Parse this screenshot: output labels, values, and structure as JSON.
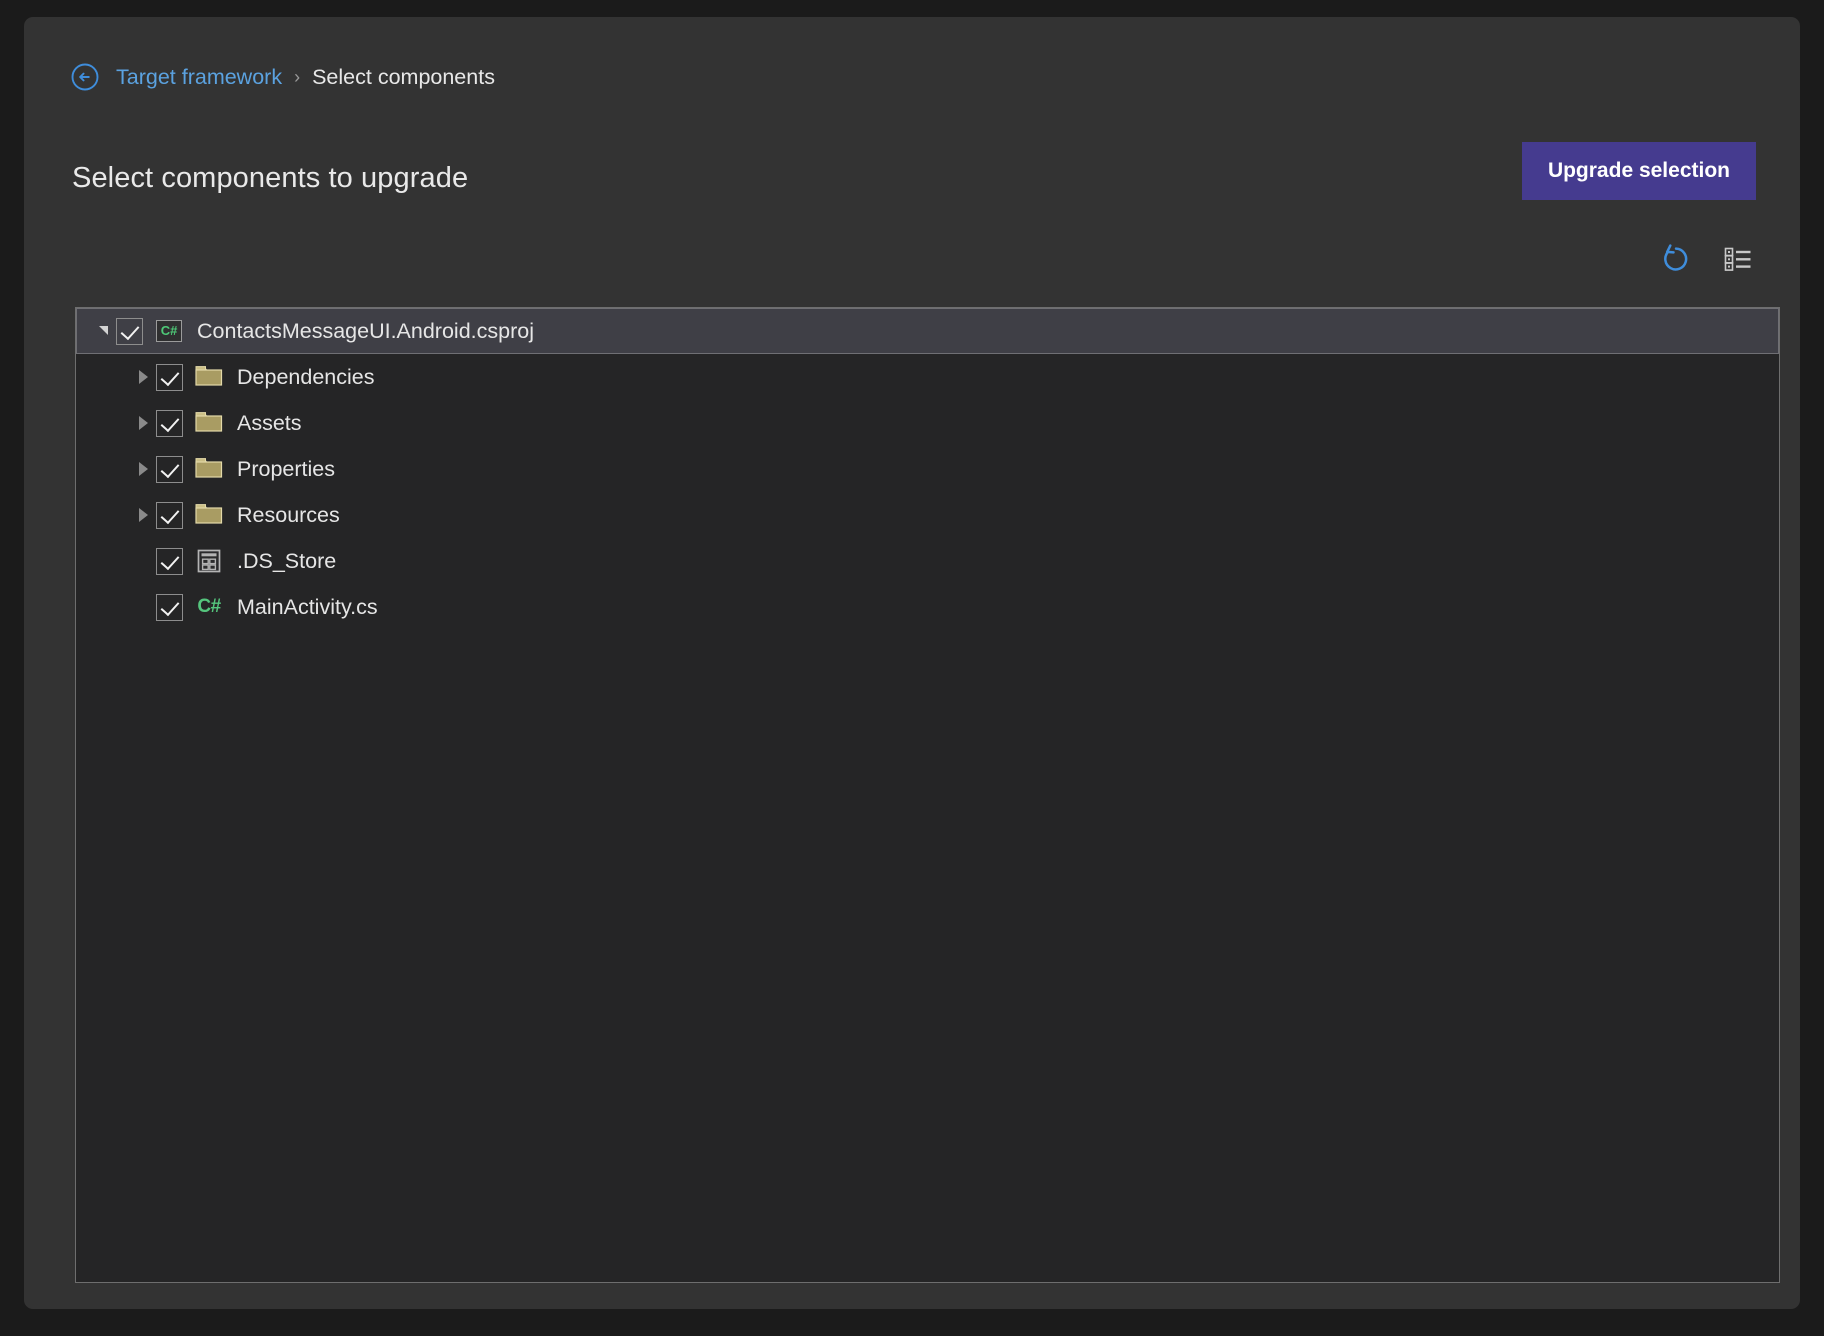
{
  "breadcrumb": {
    "back_icon": "back-arrow-circle-icon",
    "parent_label": "Target framework",
    "separator": "›",
    "current_label": "Select components"
  },
  "header": {
    "title": "Select components to upgrade",
    "upgrade_button_label": "Upgrade selection",
    "accent_color": "#453b8f"
  },
  "toolbar": {
    "refresh_icon": "refresh-icon",
    "refresh_color": "#3f8ddb",
    "view_icon": "list-view-icon",
    "view_color": "#cccccc"
  },
  "tree": {
    "nodes": [
      {
        "label": "ContactsMessageUI.Android.csproj",
        "depth": 0,
        "icon": "csproj-icon",
        "expander": "expanded",
        "checked": true,
        "selected": true
      },
      {
        "label": "Dependencies",
        "depth": 1,
        "icon": "folder-icon",
        "expander": "collapsed",
        "checked": true,
        "selected": false
      },
      {
        "label": "Assets",
        "depth": 1,
        "icon": "folder-icon",
        "expander": "collapsed",
        "checked": true,
        "selected": false
      },
      {
        "label": "Properties",
        "depth": 1,
        "icon": "folder-icon",
        "expander": "collapsed",
        "checked": true,
        "selected": false
      },
      {
        "label": "Resources",
        "depth": 1,
        "icon": "folder-icon",
        "expander": "collapsed",
        "checked": true,
        "selected": false
      },
      {
        "label": ".DS_Store",
        "depth": 1,
        "icon": "file-icon",
        "expander": "none",
        "checked": true,
        "selected": false
      },
      {
        "label": "MainActivity.cs",
        "depth": 1,
        "icon": "csharp-file-icon",
        "expander": "none",
        "checked": true,
        "selected": false
      }
    ]
  }
}
